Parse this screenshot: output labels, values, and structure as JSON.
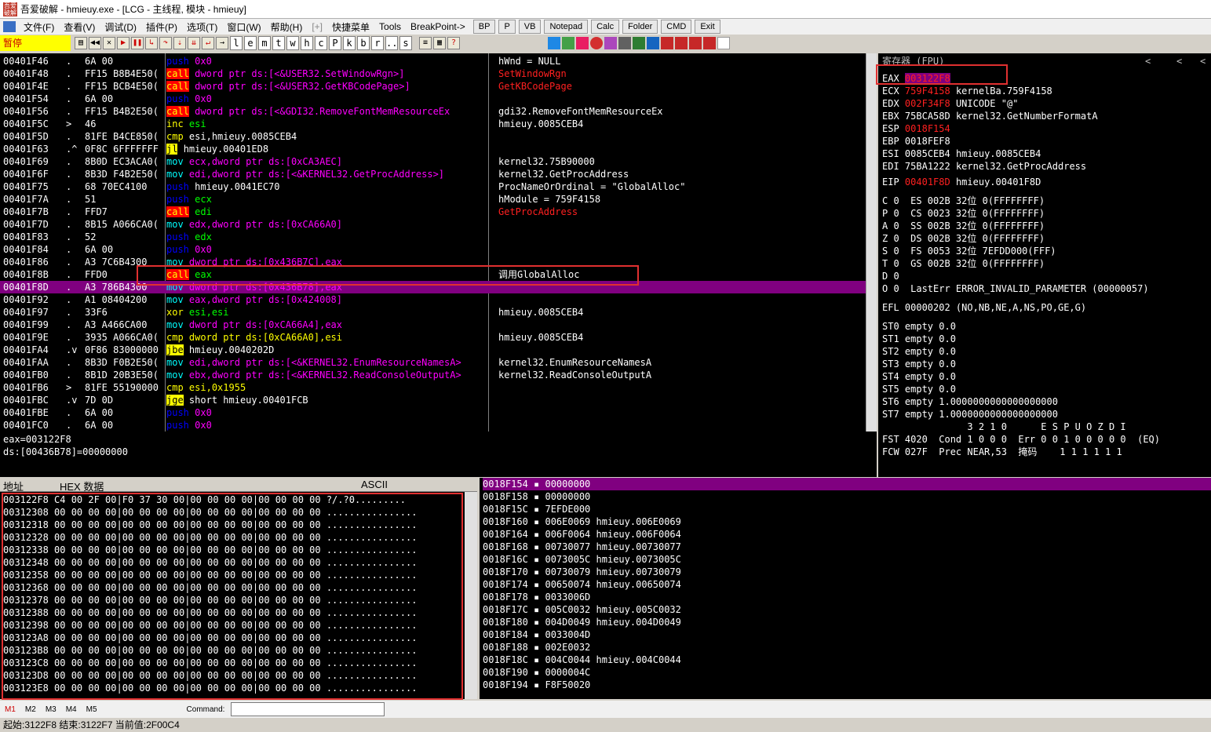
{
  "title": "吾爱破解 - hmieuy.exe - [LCG - 主线程, 模块 - hmieuy]",
  "menu": [
    "文件(F)",
    "查看(V)",
    "调试(D)",
    "插件(P)",
    "选项(T)",
    "窗口(W)",
    "帮助(H)",
    "[+]",
    "快捷菜单",
    "Tools",
    "BreakPoint->"
  ],
  "menu_tools": [
    "BP",
    "P",
    "VB",
    "Notepad",
    "Calc",
    "Folder",
    "CMD",
    "Exit"
  ],
  "state": "暂停",
  "letter_buttons": [
    "l",
    "e",
    "m",
    "t",
    "w",
    "h",
    "c",
    "P",
    "k",
    "b",
    "r",
    "...",
    "s"
  ],
  "disasm": [
    {
      "addr": "00401F46",
      "mk": ".",
      "hex": "6A 00",
      "op": "push",
      "args": "0x0",
      "cmt": "hWnd = NULL",
      "cc": "w"
    },
    {
      "addr": "00401F48",
      "mk": ".",
      "hex": "FF15 B8B4E50(",
      "op": "call",
      "args": "dword ptr ds:[<&USER32.SetWindowRgn>]",
      "cmt": "SetWindowRgn",
      "cc": "r"
    },
    {
      "addr": "00401F4E",
      "mk": ".",
      "hex": "FF15 BCB4E50(",
      "op": "call",
      "args": "dword ptr ds:[<&USER32.GetKBCodePage>]",
      "cmt": "GetKBCodePage",
      "cc": "r"
    },
    {
      "addr": "00401F54",
      "mk": ".",
      "hex": "6A 00",
      "op": "push",
      "args": "0x0",
      "cmt": "",
      "cc": "w"
    },
    {
      "addr": "00401F56",
      "mk": ".",
      "hex": "FF15 B4B2E50(",
      "op": "call",
      "args": "dword ptr ds:[<&GDI32.RemoveFontMemResourceEx",
      "cmt": "gdi32.RemoveFontMemResourceEx",
      "cc": "w"
    },
    {
      "addr": "00401F5C",
      "mk": ">",
      "hex": "46",
      "op": "inc",
      "args": "esi",
      "cmt": "hmieuy.0085CEB4",
      "cc": "w"
    },
    {
      "addr": "00401F5D",
      "mk": ".",
      "hex": "81FE B4CE850(",
      "op": "cmp",
      "args": "esi,hmieuy.0085CEB4",
      "cmt": "",
      "cc": "w"
    },
    {
      "addr": "00401F63",
      "mk": ".^",
      "hex": "0F8C 6FFFFFFF",
      "op": "jl",
      "args": "hmieuy.00401ED8",
      "cmt": "",
      "cc": "w"
    },
    {
      "addr": "00401F69",
      "mk": ".",
      "hex": "8B0D EC3ACA0(",
      "op": "mov",
      "args": "ecx,dword ptr ds:[0xCA3AEC]",
      "cmt": "kernel32.75B90000",
      "cc": "w"
    },
    {
      "addr": "00401F6F",
      "mk": ".",
      "hex": "8B3D F4B2E50(",
      "op": "mov",
      "args": "edi,dword ptr ds:[<&KERNEL32.GetProcAddress>]",
      "cmt": "kernel32.GetProcAddress",
      "cc": "w"
    },
    {
      "addr": "00401F75",
      "mk": ".",
      "hex": "68 70EC4100",
      "op": "push",
      "args": "hmieuy.0041EC70",
      "cmt": "ProcNameOrOrdinal = \"GlobalAlloc\"",
      "cc": "w"
    },
    {
      "addr": "00401F7A",
      "mk": ".",
      "hex": "51",
      "op": "push",
      "args": "ecx",
      "cmt": "hModule = 759F4158",
      "cc": "w"
    },
    {
      "addr": "00401F7B",
      "mk": ".",
      "hex": "FFD7",
      "op": "call",
      "args": "edi",
      "cmt": "GetProcAddress",
      "cc": "r"
    },
    {
      "addr": "00401F7D",
      "mk": ".",
      "hex": "8B15 A066CA0(",
      "op": "mov",
      "args": "edx,dword ptr ds:[0xCA66A0]",
      "cmt": "",
      "cc": "w"
    },
    {
      "addr": "00401F83",
      "mk": ".",
      "hex": "52",
      "op": "push",
      "args": "edx",
      "cmt": "",
      "cc": "w"
    },
    {
      "addr": "00401F84",
      "mk": ".",
      "hex": "6A 00",
      "op": "push",
      "args": "0x0",
      "cmt": "",
      "cc": "w"
    },
    {
      "addr": "00401F86",
      "mk": ".",
      "hex": "A3 7C6B4300",
      "op": "mov",
      "args": "dword ptr ds:[0x436B7C],eax",
      "cmt": "",
      "cc": "w"
    },
    {
      "addr": "00401F8B",
      "mk": ".",
      "hex": "FFD0",
      "op": "call",
      "args": "eax",
      "cmt": "调用GlobalAlloc",
      "cc": "w"
    },
    {
      "addr": "00401F8D",
      "mk": ".",
      "hex": "A3 786B4300",
      "op": "mov",
      "args": "dword ptr ds:[0x436B78],eax",
      "cmt": "",
      "cc": "w"
    },
    {
      "addr": "00401F92",
      "mk": ".",
      "hex": "A1 08404200",
      "op": "mov",
      "args": "eax,dword ptr ds:[0x424008]",
      "cmt": "",
      "cc": "w"
    },
    {
      "addr": "00401F97",
      "mk": ".",
      "hex": "33F6",
      "op": "xor",
      "args": "esi,esi",
      "cmt": "hmieuy.0085CEB4",
      "cc": "w"
    },
    {
      "addr": "00401F99",
      "mk": ".",
      "hex": "A3 A466CA00",
      "op": "mov",
      "args": "dword ptr ds:[0xCA66A4],eax",
      "cmt": "",
      "cc": "w"
    },
    {
      "addr": "00401F9E",
      "mk": ".",
      "hex": "3935 A066CA0(",
      "op": "cmp",
      "args": "dword ptr ds:[0xCA66A0],esi",
      "cmt": "hmieuy.0085CEB4",
      "cc": "w"
    },
    {
      "addr": "00401FA4",
      "mk": ".v",
      "hex": "0F86 83000000",
      "op": "jbe",
      "args": "hmieuy.0040202D",
      "cmt": "",
      "cc": "w"
    },
    {
      "addr": "00401FAA",
      "mk": ".",
      "hex": "8B3D F0B2E50(",
      "op": "mov",
      "args": "edi,dword ptr ds:[<&KERNEL32.EnumResourceNamesA>",
      "cmt": "kernel32.EnumResourceNamesA",
      "cc": "w"
    },
    {
      "addr": "00401FB0",
      "mk": ".",
      "hex": "8B1D 20B3E50(",
      "op": "mov",
      "args": "ebx,dword ptr ds:[<&KERNEL32.ReadConsoleOutputA>",
      "cmt": "kernel32.ReadConsoleOutputA",
      "cc": "w"
    },
    {
      "addr": "00401FB6",
      "mk": ">",
      "hex": "81FE 55190000",
      "op": "cmp",
      "args": "esi,0x1955",
      "cmt": "",
      "cc": "w"
    },
    {
      "addr": "00401FBC",
      "mk": ".v",
      "hex": "7D 0D",
      "op": "jge",
      "args": "short hmieuy.00401FCB",
      "cmt": "",
      "cc": "w"
    },
    {
      "addr": "00401FBE",
      "mk": ".",
      "hex": "6A 00",
      "op": "push",
      "args": "0x0",
      "cmt": "",
      "cc": "w"
    },
    {
      "addr": "00401FC0",
      "mk": ".",
      "hex": "6A 00",
      "op": "push",
      "args": "0x0",
      "cmt": "",
      "cc": "w"
    }
  ],
  "info": [
    "eax=003122F8",
    "ds:[00436B78]=00000000"
  ],
  "regs_title": "寄存器 (FPU)",
  "regs_nav": [
    "<",
    "<",
    "<"
  ],
  "regs": [
    {
      "n": "EAX",
      "v": "003122F8",
      "d": "",
      "hl": true
    },
    {
      "n": "ECX",
      "v": "759F4158",
      "d": "kernelBa.759F4158",
      "hl": false
    },
    {
      "n": "EDX",
      "v": "002F34F8",
      "d": "UNICODE \"@\"",
      "hl": false
    },
    {
      "n": "EBX",
      "v": "75BCA58D",
      "d": "kernel32.GetNumberFormatA",
      "hl": false
    },
    {
      "n": "ESP",
      "v": "0018F154",
      "d": "",
      "hl": false
    },
    {
      "n": "EBP",
      "v": "0018FEF8",
      "d": "",
      "hl": false
    },
    {
      "n": "ESI",
      "v": "0085CEB4",
      "d": "hmieuy.0085CEB4",
      "hl": false
    },
    {
      "n": "EDI",
      "v": "75BA1222",
      "d": "kernel32.GetProcAddress",
      "hl": false
    }
  ],
  "eip": {
    "n": "EIP",
    "v": "00401F8D",
    "d": "hmieuy.00401F8D"
  },
  "flags": [
    "C 0  ES 002B 32位 0(FFFFFFFF)",
    "P 0  CS 0023 32位 0(FFFFFFFF)",
    "A 0  SS 002B 32位 0(FFFFFFFF)",
    "Z 0  DS 002B 32位 0(FFFFFFFF)",
    "S 0  FS 0053 32位 7EFDD000(FFF)",
    "T 0  GS 002B 32位 0(FFFFFFFF)",
    "D 0",
    "O 0  LastErr ERROR_INVALID_PARAMETER (00000057)"
  ],
  "efl": "EFL 00000202 (NO,NB,NE,A,NS,PO,GE,G)",
  "fpu": [
    "ST0 empty 0.0",
    "ST1 empty 0.0",
    "ST2 empty 0.0",
    "ST3 empty 0.0",
    "ST4 empty 0.0",
    "ST5 empty 0.0",
    "ST6 empty 1.0000000000000000000",
    "ST7 empty 1.0000000000000000000"
  ],
  "fpu_hdr": "               3 2 1 0      E S P U O Z D I",
  "fst": "FST 4020  Cond 1 0 0 0  Err 0 0 1 0 0 0 0 0  (EQ)",
  "fcw": "FCW 027F  Prec NEAR,53  掩码    1 1 1 1 1 1",
  "dump_headers": [
    "地址",
    "HEX 数据",
    "ASCII"
  ],
  "dump": [
    {
      "a": "003122F8",
      "h": "C4 00 2F 00|F0 37 30 00|00 00 00 00|00 00 00 00",
      "t": "?/.?0........."
    },
    {
      "a": "00312308",
      "h": "00 00 00 00|00 00 00 00|00 00 00 00|00 00 00 00",
      "t": "................"
    },
    {
      "a": "00312318",
      "h": "00 00 00 00|00 00 00 00|00 00 00 00|00 00 00 00",
      "t": "................"
    },
    {
      "a": "00312328",
      "h": "00 00 00 00|00 00 00 00|00 00 00 00|00 00 00 00",
      "t": "................"
    },
    {
      "a": "00312338",
      "h": "00 00 00 00|00 00 00 00|00 00 00 00|00 00 00 00",
      "t": "................"
    },
    {
      "a": "00312348",
      "h": "00 00 00 00|00 00 00 00|00 00 00 00|00 00 00 00",
      "t": "................"
    },
    {
      "a": "00312358",
      "h": "00 00 00 00|00 00 00 00|00 00 00 00|00 00 00 00",
      "t": "................"
    },
    {
      "a": "00312368",
      "h": "00 00 00 00|00 00 00 00|00 00 00 00|00 00 00 00",
      "t": "................"
    },
    {
      "a": "00312378",
      "h": "00 00 00 00|00 00 00 00|00 00 00 00|00 00 00 00",
      "t": "................"
    },
    {
      "a": "00312388",
      "h": "00 00 00 00|00 00 00 00|00 00 00 00|00 00 00 00",
      "t": "................"
    },
    {
      "a": "00312398",
      "h": "00 00 00 00|00 00 00 00|00 00 00 00|00 00 00 00",
      "t": "................"
    },
    {
      "a": "003123A8",
      "h": "00 00 00 00|00 00 00 00|00 00 00 00|00 00 00 00",
      "t": "................"
    },
    {
      "a": "003123B8",
      "h": "00 00 00 00|00 00 00 00|00 00 00 00|00 00 00 00",
      "t": "................"
    },
    {
      "a": "003123C8",
      "h": "00 00 00 00|00 00 00 00|00 00 00 00|00 00 00 00",
      "t": "................"
    },
    {
      "a": "003123D8",
      "h": "00 00 00 00|00 00 00 00|00 00 00 00|00 00 00 00",
      "t": "................"
    },
    {
      "a": "003123E8",
      "h": "00 00 00 00|00 00 00 00|00 00 00 00|00 00 00 00",
      "t": "................"
    }
  ],
  "stack": [
    {
      "a": "0018F154",
      "v": "00000000",
      "c": ""
    },
    {
      "a": "0018F158",
      "v": "00000000",
      "c": ""
    },
    {
      "a": "0018F15C",
      "v": "7EFDE000",
      "c": ""
    },
    {
      "a": "0018F160",
      "v": "006E0069",
      "c": "hmieuy.006E0069"
    },
    {
      "a": "0018F164",
      "v": "006F0064",
      "c": "hmieuy.006F0064"
    },
    {
      "a": "0018F168",
      "v": "00730077",
      "c": "hmieuy.00730077"
    },
    {
      "a": "0018F16C",
      "v": "0073005C",
      "c": "hmieuy.0073005C"
    },
    {
      "a": "0018F170",
      "v": "00730079",
      "c": "hmieuy.00730079"
    },
    {
      "a": "0018F174",
      "v": "00650074",
      "c": "hmieuy.00650074"
    },
    {
      "a": "0018F178",
      "v": "0033006D",
      "c": ""
    },
    {
      "a": "0018F17C",
      "v": "005C0032",
      "c": "hmieuy.005C0032"
    },
    {
      "a": "0018F180",
      "v": "004D0049",
      "c": "hmieuy.004D0049"
    },
    {
      "a": "0018F184",
      "v": "0033004D",
      "c": ""
    },
    {
      "a": "0018F188",
      "v": "002E0032",
      "c": ""
    },
    {
      "a": "0018F18C",
      "v": "004C0044",
      "c": "hmieuy.004C0044"
    },
    {
      "a": "0018F190",
      "v": "0000004C",
      "c": ""
    },
    {
      "a": "0018F194",
      "v": "F8F50020",
      "c": ""
    }
  ],
  "cmd_marks": [
    "M1",
    "M2",
    "M3",
    "M4",
    "M5"
  ],
  "cmd_label": "Command:",
  "status": "起始:3122F8 结束:3122F7 当前值:2F00C4"
}
